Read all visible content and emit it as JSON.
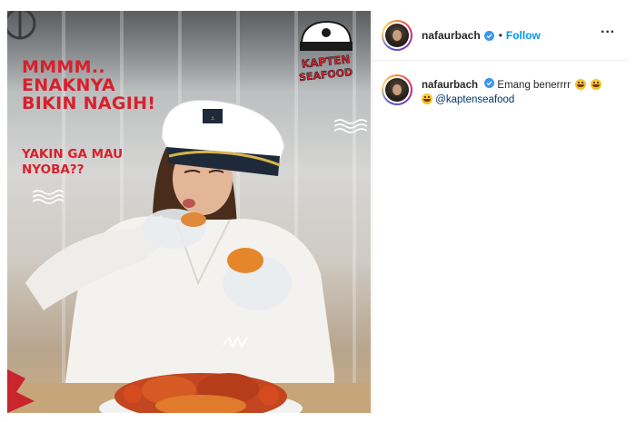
{
  "post": {
    "image": {
      "headline": [
        "MMMM..",
        "ENAKNYA",
        "BIKIN NAGIH!"
      ],
      "subline": [
        "YAKIN GA MAU",
        "NYOBA??"
      ],
      "logo_text": [
        "KAPTEN",
        "SEAFOOD"
      ],
      "cap_badge": "CAPTAIN",
      "brand_red": "#d8202c"
    },
    "header": {
      "username": "nafaurbach",
      "separator": "•",
      "follow_label": "Follow",
      "more_label": "···"
    },
    "caption": {
      "username": "nafaurbach",
      "text": "Emang benerrrr",
      "mention": "@kaptenseafood",
      "emoji": "grinning-face-emoji"
    },
    "colors": {
      "follow_blue": "#0095f6",
      "verified_blue": "#3897f0",
      "mention_blue": "#00376b"
    }
  }
}
